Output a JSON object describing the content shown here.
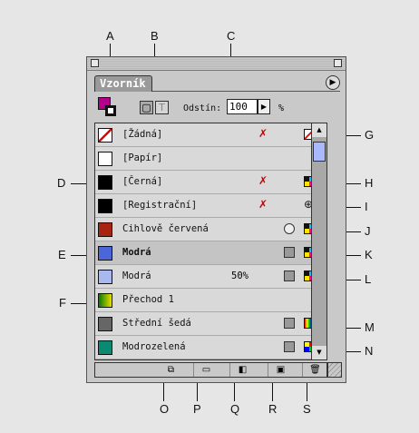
{
  "callouts": [
    "A",
    "B",
    "C",
    "D",
    "E",
    "F",
    "G",
    "H",
    "I",
    "J",
    "K",
    "L",
    "M",
    "N",
    "O",
    "P",
    "Q",
    "R",
    "S"
  ],
  "panel": {
    "tab_label": "Vzorník",
    "tint_label": "Odstín:",
    "tint_value": "100",
    "tint_unit": "%"
  },
  "swatches": [
    {
      "name": "[Žádná]",
      "color": "#ffffff",
      "icon": "none-mode-icon"
    },
    {
      "name": "[Papír]",
      "color": "#ffffff"
    },
    {
      "name": "[Černá]",
      "color": "#000000",
      "icon": "cmyk-mode-icon"
    },
    {
      "name": "[Registrační]",
      "color": "#000000",
      "icon": "registration-icon"
    },
    {
      "name": "Cihlově červená",
      "color": "#a82410",
      "icon": "cmyk-mode-icon"
    },
    {
      "name": "Modrá",
      "color": "#4a66d8",
      "icon": "cmyk-mode-icon"
    },
    {
      "name": "Modrá",
      "color": "#aab8f0",
      "tint": "50%",
      "icon": "cmyk-mode-icon"
    },
    {
      "name": "Přechod 1",
      "color": "gradient",
      "icon": ""
    },
    {
      "name": "Střední šedá",
      "color": "#666666",
      "icon": "rgb-mode-icon"
    },
    {
      "name": "Modrozelená",
      "color": "#0a8a70",
      "icon": "lab-mode-icon"
    }
  ]
}
